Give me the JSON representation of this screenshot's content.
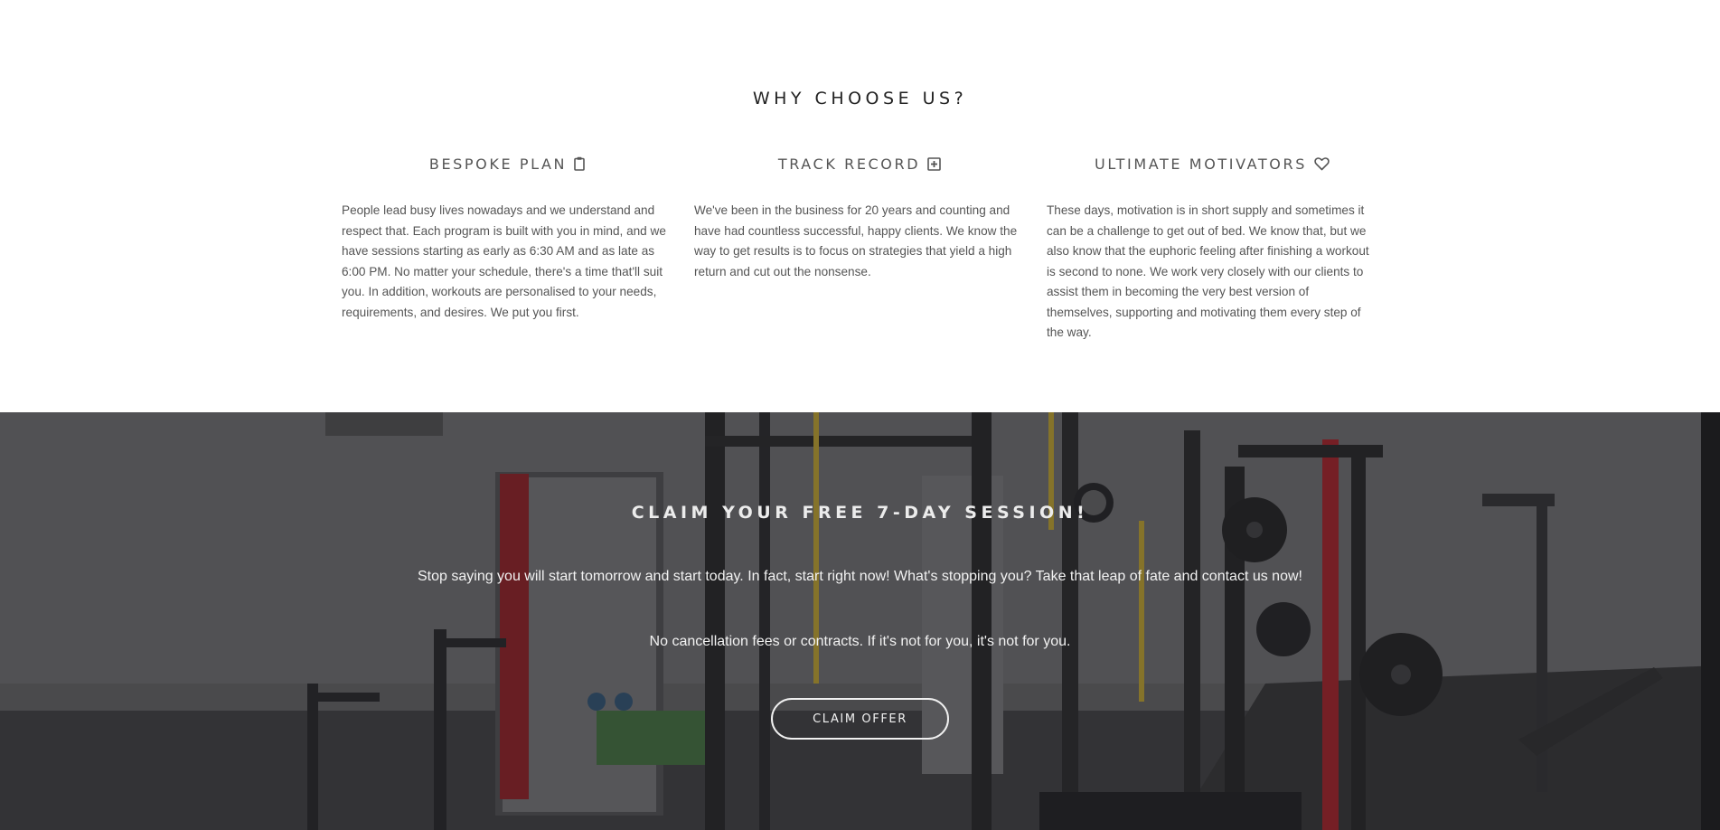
{
  "why_section": {
    "title": "WHY CHOOSE US?",
    "features": [
      {
        "heading": "BESPOKE PLAN",
        "icon": "clipboard-icon",
        "body": "People lead busy lives nowadays and we understand and respect that. Each program is built with you in mind, and we have sessions starting as early as 6:30 AM and as late as 6:00 PM. No matter your schedule, there's a time that'll suit you. In addition, workouts are personalised to your needs, requirements, and desires. We put you first."
      },
      {
        "heading": "TRACK RECORD",
        "icon": "plus-square-icon",
        "body": "We've been in the business for 20 years and counting and have had countless successful, happy clients. We know the way to get results is to focus on strategies that yield a high return and cut out the nonsense."
      },
      {
        "heading": "ULTIMATE MOTIVATORS",
        "icon": "heart-icon",
        "body": "These days, motivation is in short supply and sometimes it can be a challenge to get out of bed. We know that, but we also know that the euphoric feeling after finishing a workout is second to none. We work very closely with our clients to assist them in becoming the very best version of themselves, supporting and motivating them every step of the way."
      }
    ]
  },
  "cta_section": {
    "title": "CLAIM YOUR FREE 7-DAY SESSION!",
    "text_1": "Stop saying you will start tomorrow and start today. In fact, start right now! What's stopping you? Take that leap of fate and contact us now!",
    "text_2": "No cancellation fees or contracts. If it's not for you, it's not for you.",
    "button_label": "CLAIM OFFER"
  },
  "colors": {
    "heading": "#222222",
    "text": "#555555",
    "cta_text": "#f2f2f2",
    "accent_red": "#9e1b22"
  }
}
